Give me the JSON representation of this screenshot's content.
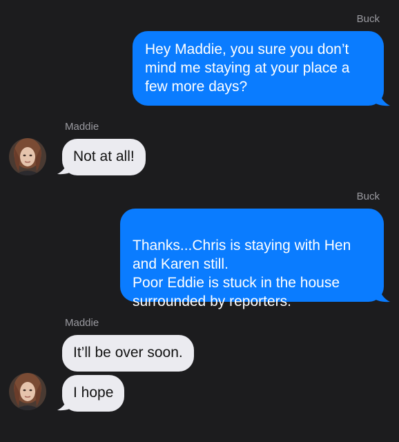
{
  "conversation": {
    "messages": [
      {
        "sender": "Buck",
        "direction": "outgoing",
        "text": "Hey Maddie, you sure you don’t mind me staying at your place a few more days?"
      },
      {
        "sender": "Maddie",
        "direction": "incoming",
        "text": "Not at all!"
      },
      {
        "sender": "Buck",
        "direction": "outgoing",
        "text": "Thanks...Chris is staying with Hen and Karen still.\nPoor Eddie is stuck in the house surrounded by reporters."
      },
      {
        "sender": "Maddie",
        "direction": "incoming",
        "text": "It’ll be over soon."
      },
      {
        "sender": "Maddie",
        "direction": "incoming",
        "text": "I hope"
      }
    ]
  },
  "colors": {
    "background": "#1c1c1e",
    "outgoing_bubble": "#0a7cff",
    "incoming_bubble": "#ebebf0",
    "sender_label": "#9a9aa0"
  },
  "icons": {
    "avatar": "contact-photo-icon"
  }
}
